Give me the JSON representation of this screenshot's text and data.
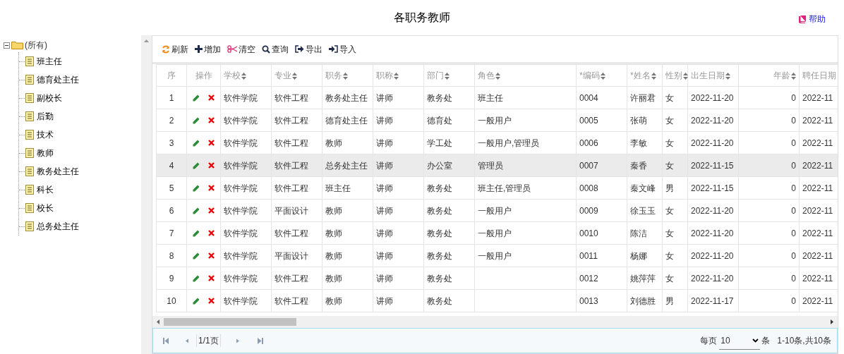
{
  "title": "各职务教师",
  "help": "帮助",
  "tree": {
    "label": "(所有)",
    "expanded": true,
    "children": [
      {
        "label": "班主任"
      },
      {
        "label": "德育处主任"
      },
      {
        "label": "副校长"
      },
      {
        "label": "后勤"
      },
      {
        "label": "技术"
      },
      {
        "label": "教师"
      },
      {
        "label": "教务处主任"
      },
      {
        "label": "科长"
      },
      {
        "label": "校长"
      },
      {
        "label": "总务处主任"
      }
    ]
  },
  "toolbar": [
    {
      "kind": "refresh",
      "label": "刷新"
    },
    {
      "kind": "add",
      "label": "增加"
    },
    {
      "kind": "clear",
      "label": "清空"
    },
    {
      "kind": "search",
      "label": "查询"
    },
    {
      "kind": "export",
      "label": "导出"
    },
    {
      "kind": "import",
      "label": "导入"
    }
  ],
  "table": {
    "columns": [
      {
        "label": "序",
        "sortable": false
      },
      {
        "label": "操作",
        "sortable": false
      },
      {
        "label": "学校",
        "sortable": true
      },
      {
        "label": "专业",
        "sortable": true
      },
      {
        "label": "职务",
        "sortable": true
      },
      {
        "label": "职称",
        "sortable": true
      },
      {
        "label": "部门",
        "sortable": true
      },
      {
        "label": "角色",
        "sortable": true
      },
      {
        "label": "*编码",
        "sortable": true
      },
      {
        "label": "*姓名",
        "sortable": true
      },
      {
        "label": "性别",
        "sortable": true
      },
      {
        "label": "出生日期",
        "sortable": true
      },
      {
        "label": "年龄",
        "sortable": true
      },
      {
        "label": "聘任日期"
      }
    ],
    "rows": [
      {
        "selected": false,
        "cells": [
          "1",
          "",
          "软件学院",
          "软件工程",
          "教务处主任",
          "讲师",
          "教务处",
          "班主任",
          "0004",
          "许丽君",
          "女",
          "2022-11-20",
          "0",
          "2022-11"
        ]
      },
      {
        "selected": false,
        "cells": [
          "2",
          "",
          "软件学院",
          "软件工程",
          "德育处主任",
          "讲师",
          "德育处",
          "一般用户",
          "0005",
          "张萌",
          "女",
          "2022-11-20",
          "0",
          "2022-11"
        ]
      },
      {
        "selected": false,
        "cells": [
          "3",
          "",
          "软件学院",
          "软件工程",
          "教师",
          "讲师",
          "学工处",
          "一般用户,管理员",
          "0006",
          "李敏",
          "女",
          "2022-11-20",
          "0",
          "2022-11"
        ]
      },
      {
        "selected": true,
        "cells": [
          "4",
          "",
          "软件学院",
          "软件工程",
          "总务处主任",
          "讲师",
          "办公室",
          "管理员",
          "0007",
          "秦香",
          "女",
          "2022-11-15",
          "0",
          "2022-11"
        ]
      },
      {
        "selected": false,
        "cells": [
          "5",
          "",
          "软件学院",
          "软件工程",
          "班主任",
          "讲师",
          "教务处",
          "班主任,管理员",
          "0008",
          "秦文峰",
          "男",
          "2022-11-15",
          "0",
          "2022-11"
        ]
      },
      {
        "selected": false,
        "cells": [
          "6",
          "",
          "软件学院",
          "平面设计",
          "教师",
          "讲师",
          "教务处",
          "一般用户",
          "0009",
          "徐玉玉",
          "女",
          "2022-11-20",
          "0",
          "2022-11"
        ]
      },
      {
        "selected": false,
        "cells": [
          "7",
          "",
          "软件学院",
          "软件工程",
          "教师",
          "讲师",
          "教务处",
          "一般用户",
          "0010",
          "陈洁",
          "女",
          "2022-11-20",
          "0",
          "2022-11"
        ]
      },
      {
        "selected": false,
        "cells": [
          "8",
          "",
          "软件学院",
          "平面设计",
          "教师",
          "讲师",
          "教务处",
          "一般用户",
          "0011",
          "杨娜",
          "女",
          "2022-11-20",
          "0",
          "2022-11"
        ]
      },
      {
        "selected": false,
        "cells": [
          "9",
          "",
          "软件学院",
          "软件工程",
          "教师",
          "讲师",
          "教务处",
          "",
          "0012",
          "姚萍萍",
          "女",
          "2022-11-20",
          "0",
          "2022-11"
        ]
      },
      {
        "selected": false,
        "cells": [
          "10",
          "",
          "软件学院",
          "软件工程",
          "教师",
          "讲师",
          "教务处",
          "",
          "0013",
          "刘德胜",
          "男",
          "2022-11-17",
          "0",
          "2022-11"
        ]
      }
    ]
  },
  "pager": {
    "page": "1/1页",
    "per_page_label": "每页",
    "per_page": "10",
    "unit": "条",
    "summary": "1-10条,共10条"
  }
}
